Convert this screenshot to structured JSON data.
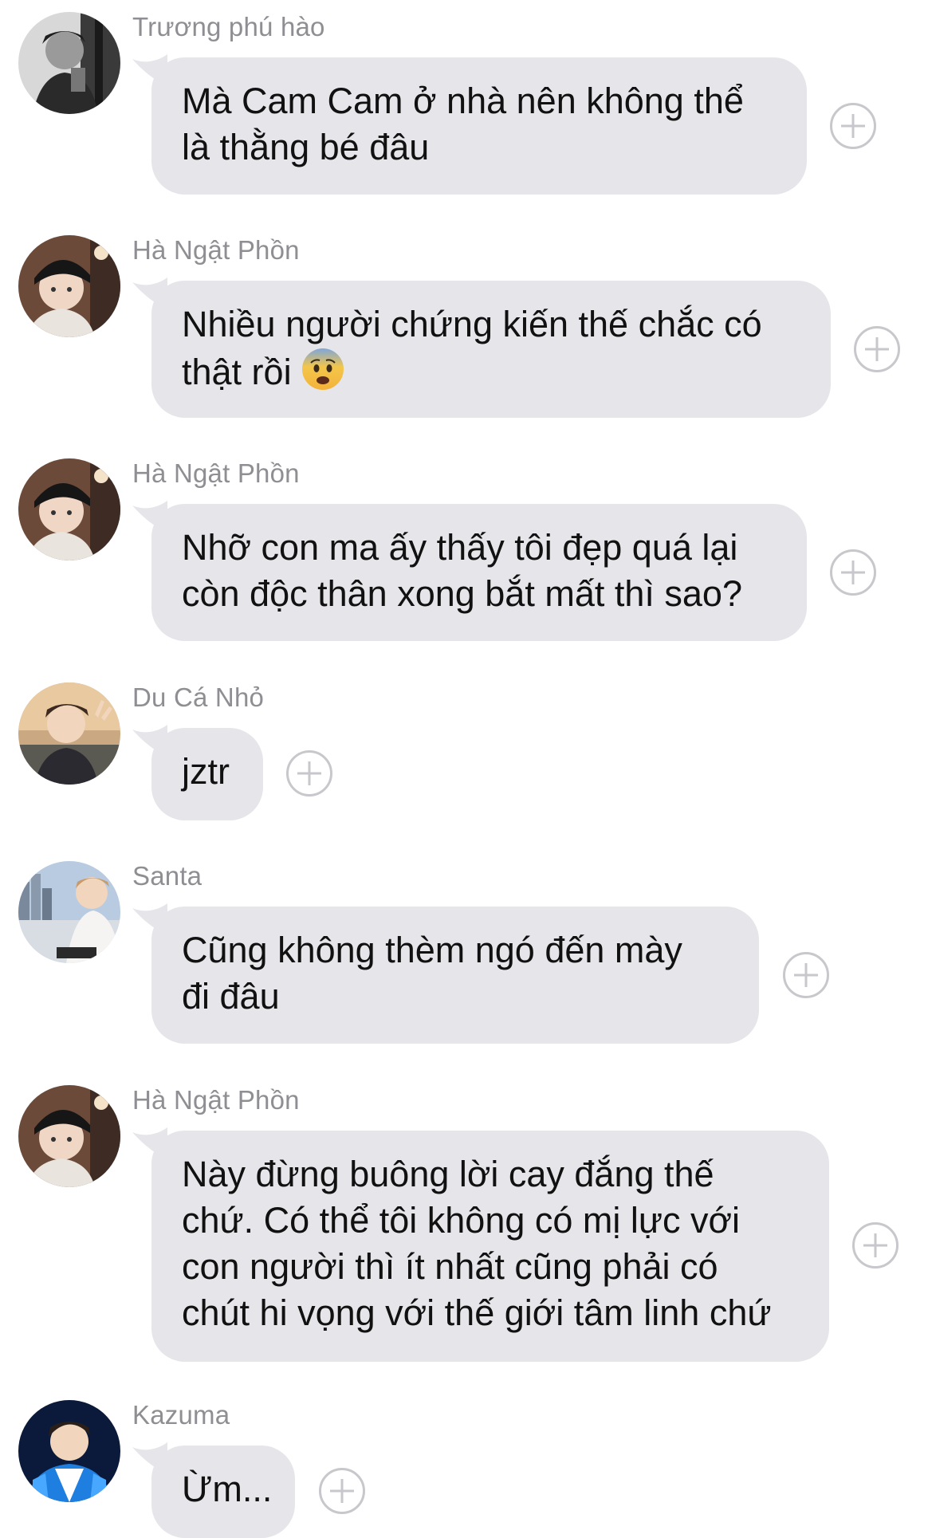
{
  "messages": [
    {
      "sender": "Trương phú hào",
      "lines": [
        "Mà Cam Cam ở nhà nên không thể",
        "là thằng bé đâu"
      ],
      "avatar": "avatar-dark-portrait"
    },
    {
      "sender": "Hà Ngật Phồn",
      "lines": [
        "Nhiều người chứng kiến thế chắc có",
        "thật rồi"
      ],
      "emoji": "fearful-face-emoji",
      "avatar": "avatar-beanie-portrait"
    },
    {
      "sender": "Hà Ngật Phồn",
      "lines": [
        "Nhỡ con ma ấy thấy tôi đẹp quá lại",
        "còn độc thân xong bắt mất thì sao?"
      ],
      "avatar": "avatar-beanie-portrait"
    },
    {
      "sender": "Du Cá Nhỏ",
      "lines": [
        "jztr"
      ],
      "avatar": "avatar-peace-sign-portrait"
    },
    {
      "sender": "Santa",
      "lines": [
        "Cũng không thèm ngó đến mày",
        "đi đâu"
      ],
      "avatar": "avatar-city-portrait"
    },
    {
      "sender": "Hà Ngật Phồn",
      "lines": [
        "Này đừng buông lời cay đắng thế",
        "chứ. Có thể tôi không có mị lực với",
        "con người thì ít nhất cũng phải có",
        "chút hi vọng với thế giới tâm linh chứ"
      ],
      "avatar": "avatar-beanie-portrait"
    },
    {
      "sender": "Kazuma",
      "lines": [
        "Ừm..."
      ],
      "avatar": "avatar-blue-jacket-portrait"
    }
  ],
  "colors": {
    "bubble": "#e5e5ea",
    "sender": "#8e8e93",
    "plus": "#c7c7cc"
  }
}
